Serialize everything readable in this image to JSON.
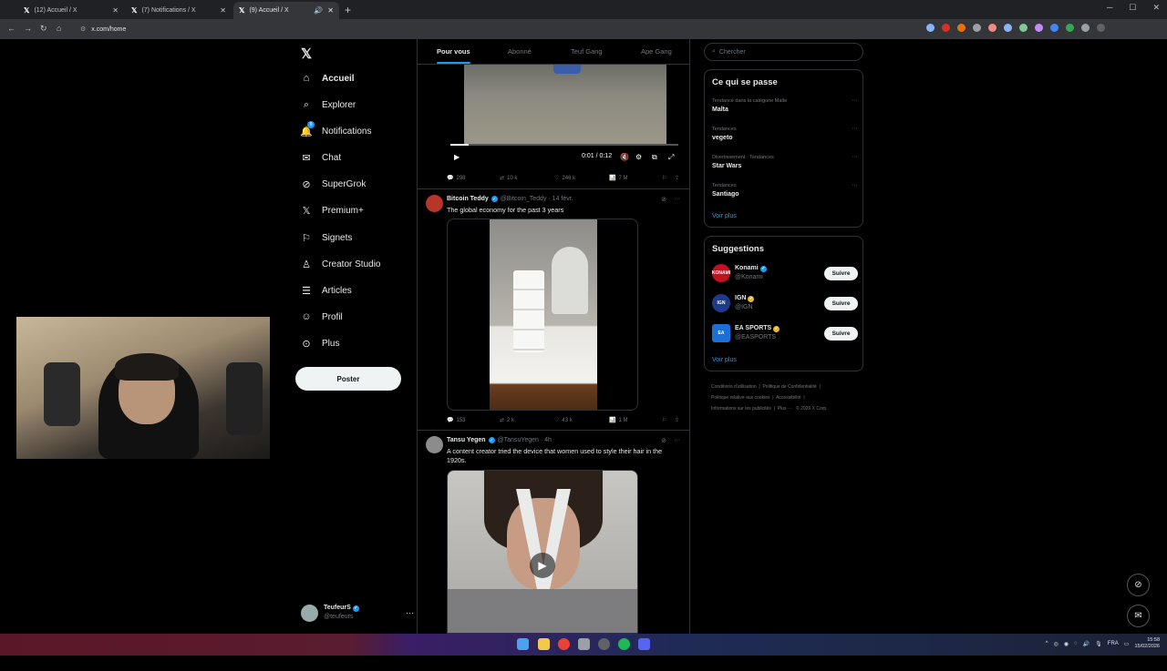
{
  "browser": {
    "tabs": [
      {
        "title": "(12) Accueil / X",
        "active": false
      },
      {
        "title": "(7) Notifications / X",
        "active": false
      },
      {
        "title": "(9) Accueil / X",
        "active": true
      }
    ],
    "url": "x.com/home"
  },
  "sidebar": {
    "items": [
      {
        "label": "Accueil",
        "icon": "home-icon",
        "active": true
      },
      {
        "label": "Explorer",
        "icon": "search-icon"
      },
      {
        "label": "Notifications",
        "icon": "bell-icon",
        "badge": "9"
      },
      {
        "label": "Chat",
        "icon": "mail-icon"
      },
      {
        "label": "SuperGrok",
        "icon": "grok-icon"
      },
      {
        "label": "Premium+",
        "icon": "x-icon"
      },
      {
        "label": "Signets",
        "icon": "bookmark-icon"
      },
      {
        "label": "Creator Studio",
        "icon": "creator-icon"
      },
      {
        "label": "Articles",
        "icon": "articles-icon"
      },
      {
        "label": "Profil",
        "icon": "person-icon"
      },
      {
        "label": "Plus",
        "icon": "more-circle-icon"
      }
    ],
    "post_label": "Poster",
    "account": {
      "name": "TeufeurS",
      "handle": "@teufeurs"
    }
  },
  "feed": {
    "tabs": [
      "Pour vous",
      "Abonné",
      "Teuf Gang",
      "Ape Gang"
    ],
    "video1": {
      "time": "0:01 / 0:12",
      "stats": {
        "replies": "298",
        "reposts": "10 k",
        "likes": "246 k",
        "views": "7 M"
      }
    },
    "tweet2": {
      "name": "Bitcoin Teddy",
      "meta": "@Bitcoin_Teddy · 14 févr.",
      "text": "The global economy for the past 3 years",
      "stats": {
        "replies": "153",
        "reposts": "2 k",
        "likes": "43 k",
        "views": "1 M"
      }
    },
    "tweet3": {
      "name": "Tansu Yegen",
      "meta": "@TansuYegen · 4h",
      "text": "A content creator tried the device that women used to style their hair in the 1920s."
    }
  },
  "right": {
    "search_placeholder": "Chercher",
    "trends_title": "Ce qui se passe",
    "trends": [
      {
        "category": "Tendance dans la catégorie Malte",
        "name": "Malta"
      },
      {
        "category": "Tendances",
        "name": "vegeto"
      },
      {
        "category": "Divertissement · Tendances",
        "name": "Star Wars"
      },
      {
        "category": "Tendances",
        "name": "Santiago"
      }
    ],
    "see_more": "Voir plus",
    "suggestions_title": "Suggestions",
    "suggestions": [
      {
        "name": "Konami",
        "handle": "@Konami",
        "avatar_text": "KONAMI",
        "color": "#c1121f"
      },
      {
        "name": "IGN",
        "handle": "@IGN",
        "avatar_text": "IGN",
        "color": "#1f3a8a"
      },
      {
        "name": "EA SPORTS",
        "handle": "@EASPORTS",
        "avatar_text": "EA",
        "color": "#1d6fd8"
      }
    ],
    "follow_label": "Suivre",
    "footer": [
      "Conditions d'utilisation",
      "Politique de Confidentialité",
      "Politique relative aux cookies",
      "Accessibilité",
      "Informations sur les publicités",
      "Plus ···",
      "© 2026 X Corp."
    ]
  },
  "taskbar": {
    "lang": "FRA",
    "time": "15:58",
    "date": "15/02/2026"
  }
}
